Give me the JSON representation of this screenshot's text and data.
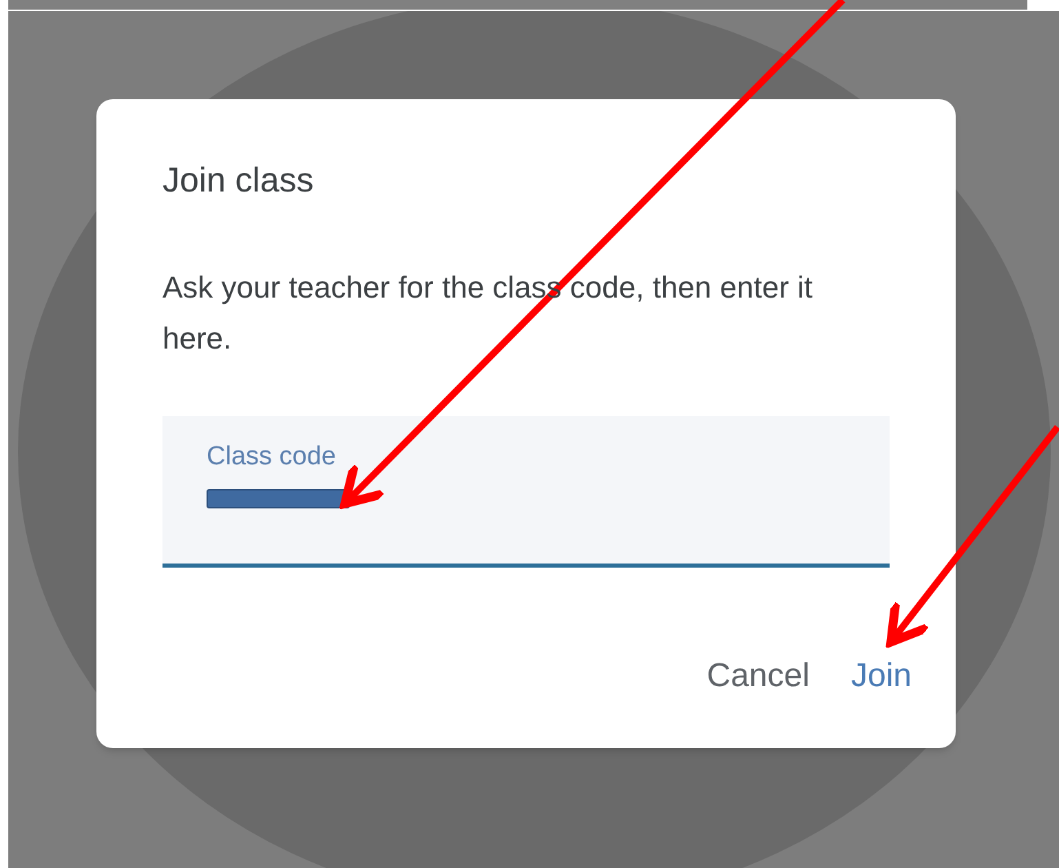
{
  "dialog": {
    "title": "Join class",
    "message": "Ask your teacher for the class code, then enter it here.",
    "field": {
      "label": "Class code",
      "focused": true
    },
    "buttons": [
      {
        "label": "Cancel",
        "kind": "secondary"
      },
      {
        "label": "Join",
        "kind": "primary"
      }
    ]
  }
}
